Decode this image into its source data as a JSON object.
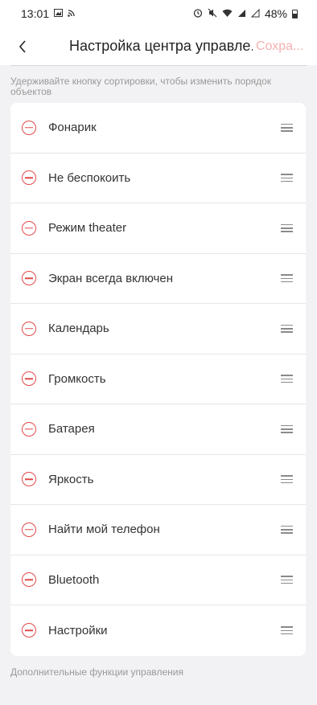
{
  "status_bar": {
    "time": "13:01",
    "battery": "48%",
    "icons": [
      "image-icon",
      "cast-icon",
      "alarm-icon",
      "mute-icon",
      "wifi-icon",
      "signal-icon",
      "signal-icon",
      "battery-icon"
    ]
  },
  "header": {
    "back_icon": "chevron-left-icon",
    "title": "Настройка центра управле...",
    "save_label": "Сохра..."
  },
  "hint": "Удерживайте кнопку сортировки, чтобы изменить порядок объектов",
  "items": [
    {
      "label": "Фонарик"
    },
    {
      "label": "Не беспокоить"
    },
    {
      "label": "Режим theater"
    },
    {
      "label": "Экран всегда включен"
    },
    {
      "label": "Календарь"
    },
    {
      "label": "Громкость"
    },
    {
      "label": "Батарея"
    },
    {
      "label": "Яркость"
    },
    {
      "label": "Найти мой телефон"
    },
    {
      "label": "Bluetooth"
    },
    {
      "label": "Настройки"
    }
  ],
  "section_title": "Дополнительные функции управления",
  "colors": {
    "remove": "#e24a4a",
    "save_disabled": "#f6b0b0",
    "background": "#f2f2f4"
  }
}
